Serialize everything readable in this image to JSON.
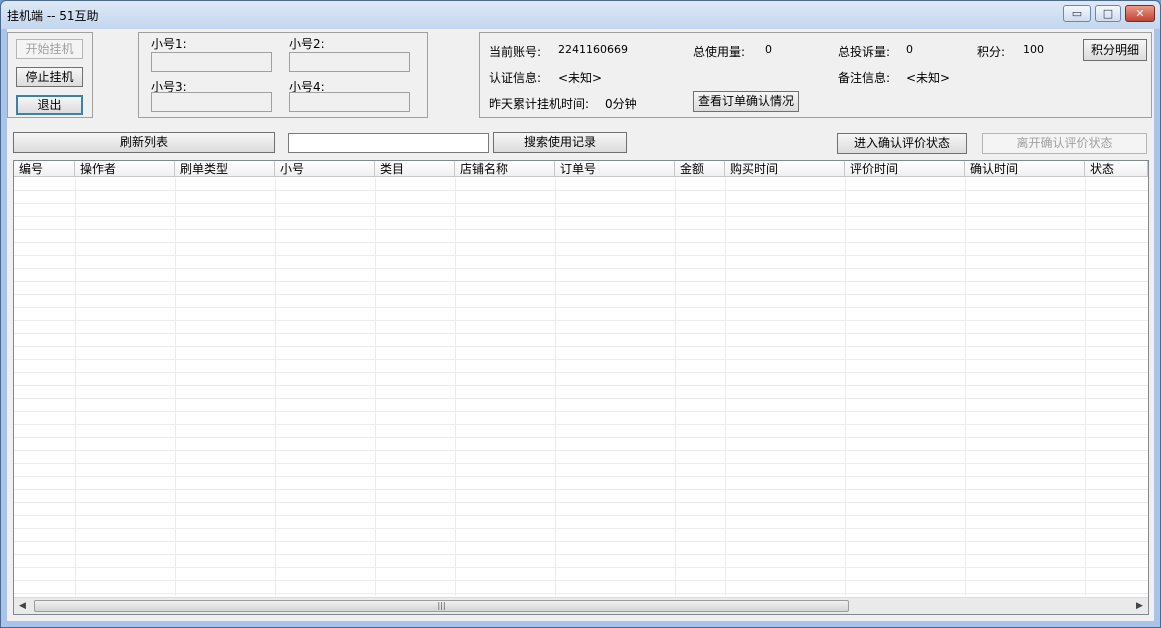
{
  "window": {
    "title": "挂机端 -- 51互助",
    "minimize_glyph": "▭",
    "maximize_glyph": "□",
    "close_glyph": "✕"
  },
  "controls": {
    "start_label": "开始挂机",
    "stop_label": "停止挂机",
    "exit_label": "退出"
  },
  "accounts": {
    "label1": "小号1:",
    "label2": "小号2:",
    "label3": "小号3:",
    "label4": "小号4:",
    "value1": "",
    "value2": "",
    "value3": "",
    "value4": ""
  },
  "info": {
    "account_label": "当前账号:",
    "account_value": "2241160669",
    "usage_label": "总使用量:",
    "usage_value": "0",
    "complaints_label": "总投诉量:",
    "complaints_value": "0",
    "points_label": "积分:",
    "points_value": "100",
    "points_detail_label": "积分明细",
    "auth_label": "认证信息:",
    "auth_value": "<未知>",
    "remark_label": "备注信息:",
    "remark_value": "<未知>",
    "yesterday_label": "昨天累计挂机时间:",
    "yesterday_value": "0分钟",
    "check_orders_label": "查看订单确认情况"
  },
  "toolbar": {
    "refresh_label": "刷新列表",
    "search_value": "",
    "search_label": "搜索使用记录",
    "enter_confirm_label": "进入确认评价状态",
    "leave_confirm_label": "离开确认评价状态"
  },
  "table": {
    "columns": [
      "编号",
      "操作者",
      "刷单类型",
      "小号",
      "类目",
      "店铺名称",
      "订单号",
      "金额",
      "购买时间",
      "评价时间",
      "确认时间",
      "状态"
    ],
    "rows": []
  },
  "scrollbar": {
    "left_glyph": "◀",
    "right_glyph": "▶",
    "thumb_grip": "|||"
  }
}
